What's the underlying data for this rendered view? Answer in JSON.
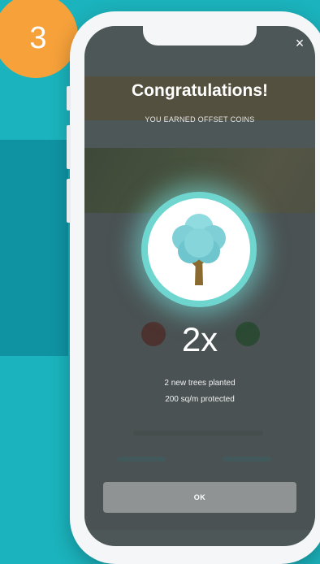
{
  "step": {
    "number": "3"
  },
  "modal": {
    "title": "Congratulations!",
    "subtitle": "YOU EARNED OFFSET COINS",
    "multiplier": "2x",
    "stats": [
      "2 new trees planted",
      "200 sq/m protected"
    ],
    "ok_label": "OK",
    "close_symbol": "×"
  },
  "icons": {
    "tree": "tree-icon",
    "close": "close-icon"
  },
  "colors": {
    "background": "#1bb3bd",
    "badge": "#f6a13a",
    "ring": "#6fd6cf",
    "tree_canopy": "#7ed0d6",
    "tree_trunk": "#8a6a2e"
  }
}
